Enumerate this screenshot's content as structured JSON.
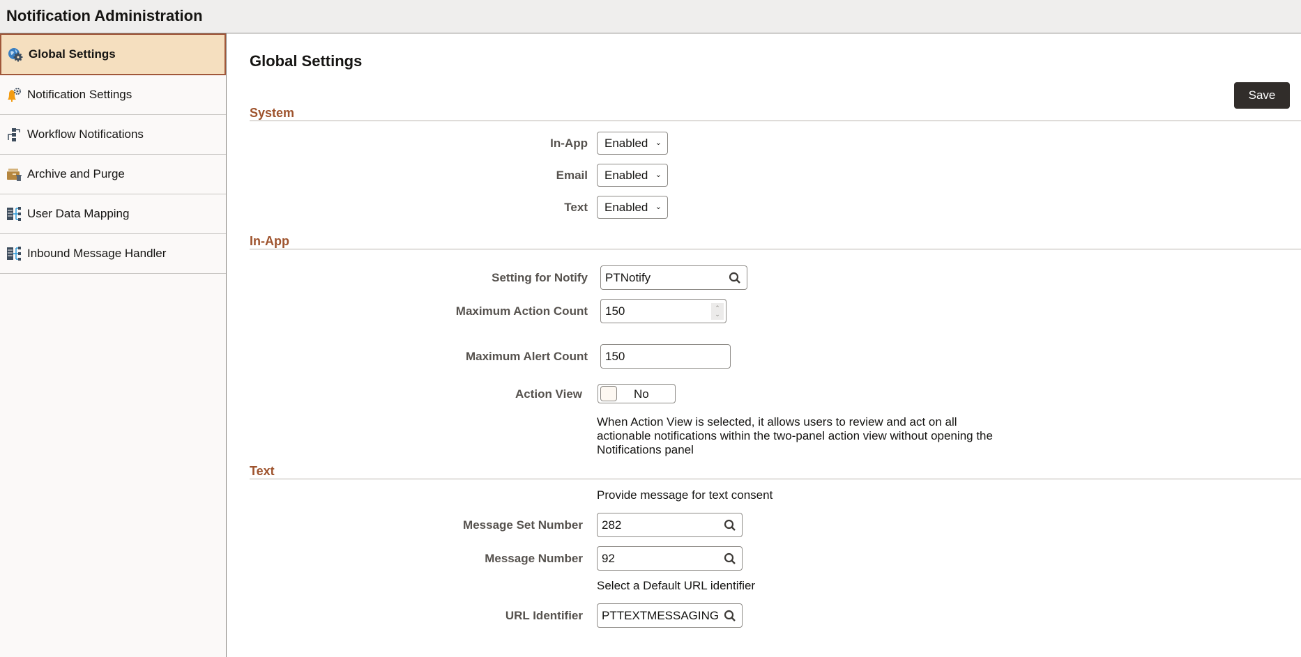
{
  "header": {
    "title": "Notification Administration"
  },
  "sidebar": {
    "items": [
      {
        "label": "Global Settings",
        "icon": "globe-gear-icon",
        "active": true
      },
      {
        "label": "Notification Settings",
        "icon": "bell-gear-icon",
        "active": false
      },
      {
        "label": "Workflow Notifications",
        "icon": "workflow-icon",
        "active": false
      },
      {
        "label": "Archive and Purge",
        "icon": "archive-purge-icon",
        "active": false
      },
      {
        "label": "User Data Mapping",
        "icon": "data-mapping-icon",
        "active": false
      },
      {
        "label": "Inbound Message Handler",
        "icon": "data-mapping-icon",
        "active": false
      }
    ]
  },
  "main": {
    "title": "Global Settings",
    "save_label": "Save",
    "sections": {
      "system": {
        "heading": "System",
        "fields": [
          {
            "label": "In-App",
            "value": "Enabled"
          },
          {
            "label": "Email",
            "value": "Enabled"
          },
          {
            "label": "Text",
            "value": "Enabled"
          }
        ]
      },
      "inapp": {
        "heading": "In-App",
        "setting_for_notify": {
          "label": "Setting for Notify",
          "value": "PTNotify"
        },
        "max_action_count": {
          "label": "Maximum Action Count",
          "value": "150"
        },
        "max_alert_count": {
          "label": "Maximum Alert Count",
          "value": "150"
        },
        "action_view": {
          "label": "Action View",
          "value": "No"
        },
        "action_view_help": "When Action View is selected, it allows users to review and act on all actionable notifications within the two-panel action view without opening the Notifications panel"
      },
      "text": {
        "heading": "Text",
        "consent_help": "Provide message for text consent",
        "message_set_number": {
          "label": "Message Set Number",
          "value": "282"
        },
        "message_number": {
          "label": "Message Number",
          "value": "92"
        },
        "url_help": "Select a Default URL identifier",
        "url_identifier": {
          "label": "URL Identifier",
          "value": "PTTEXTMESSAGING"
        }
      }
    }
  },
  "colors": {
    "accent_brown": "#9e532d",
    "active_bg": "#f5dfbf",
    "save_bg": "#312d2a"
  }
}
